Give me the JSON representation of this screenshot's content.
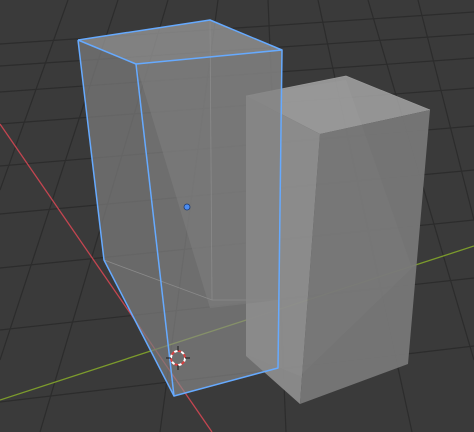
{
  "viewport": {
    "editor": "3D Viewport",
    "view_mode": "perspective",
    "shading_mode": "x-ray",
    "background_color": "#3a3a3a",
    "grid_color": "#2c2c2c",
    "x_axis_color": "#c34550",
    "y_axis_color": "#7c9b2c"
  },
  "objects": [
    {
      "id": "selected-box",
      "type": "box",
      "selected": true,
      "active": true,
      "face_colors": {
        "front": "#7c7c7c",
        "side": "#8a8a8a",
        "top": "#9a9a9a",
        "interior": "#6e6e6e"
      },
      "outline_color": "#66aaff",
      "origin_color": "#4c8cf0"
    },
    {
      "id": "unselected-box",
      "type": "box",
      "selected": false,
      "active": false,
      "face_colors": {
        "front": "#8f8f8f",
        "side": "#7a7a7a",
        "top": "#a0a0a0",
        "interior": "#6e6e6e"
      }
    }
  ],
  "cursor_3d": {
    "icon": "3d-cursor-icon",
    "ring_colors": [
      "#d84040",
      "#ffffff"
    ]
  }
}
